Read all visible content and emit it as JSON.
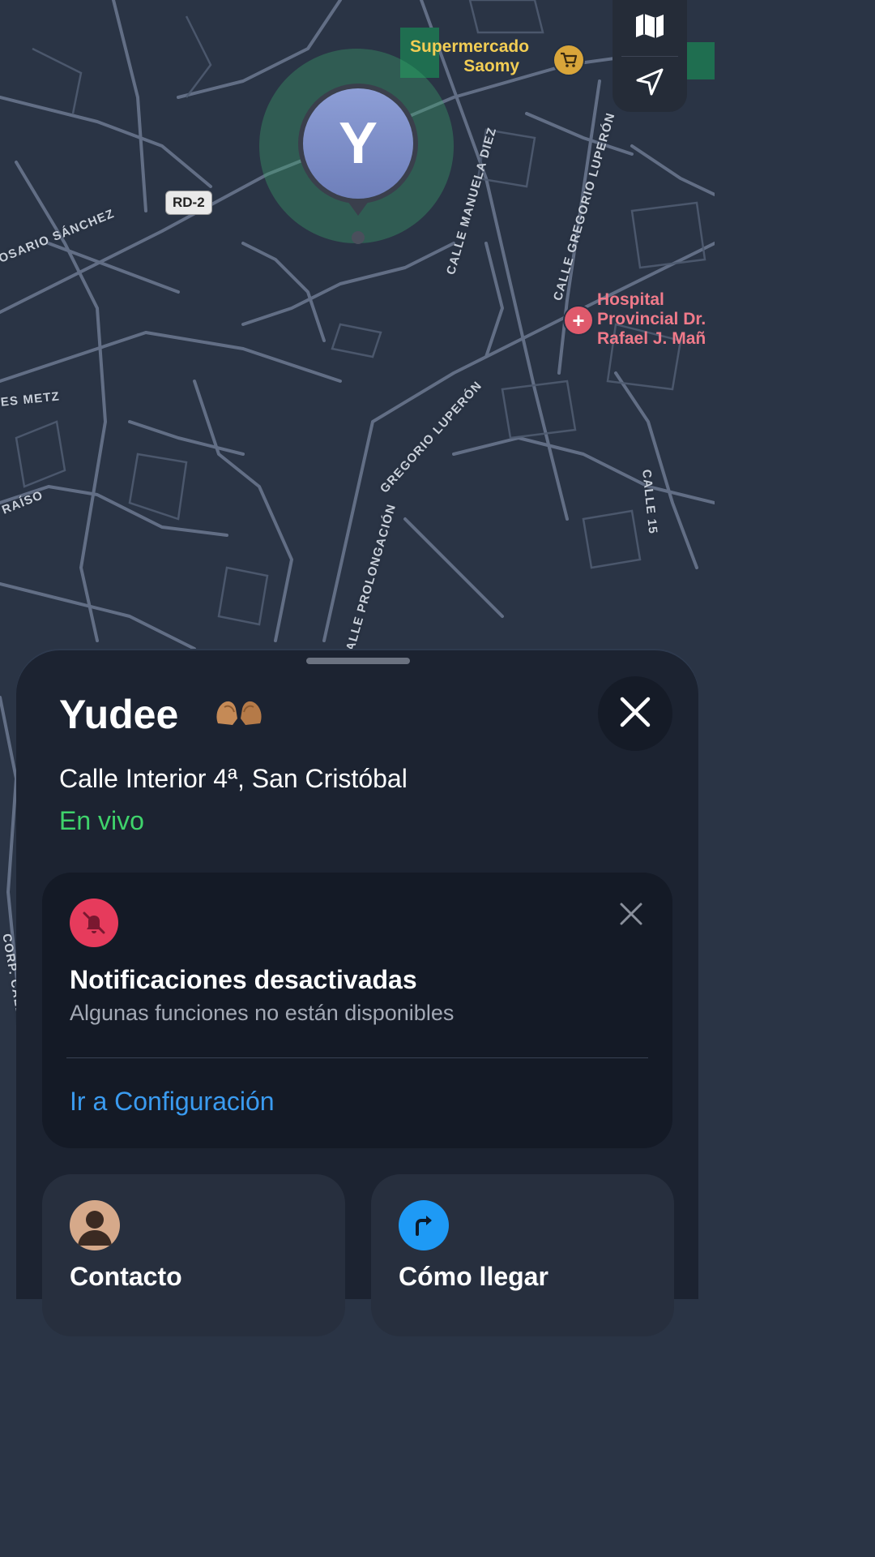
{
  "map": {
    "pois": {
      "supermarket": {
        "name_line1": "Supermercado",
        "name_line2": "Saomy",
        "color": "#f2cd54",
        "icon": "shopping-cart-icon"
      },
      "hospital": {
        "name_line1": "Hospital",
        "name_line2": "Provincial Dr.",
        "name_line3": "Rafael J. Mañ",
        "color": "#f07a8a",
        "icon": "hospital-cross-icon"
      }
    },
    "road_shield": "RD-2",
    "streets": {
      "rosario_sanchez": "OSARIO SÁNCHEZ",
      "manuela_diez": "CALLE MANUELA DIEZ",
      "gregorio_luperon_1": "CALLE GREGORIO LUPERÓN",
      "gregorio_luperon_2": "GREGORIO LUPERÓN",
      "prolongacion": "ALLE PROLONGACIÓN",
      "es_metz": "ES METZ",
      "raiso": "RAÍSO",
      "calle_15": "CALLE 15",
      "corp_calle": "CORP. CALLE"
    },
    "user_pin": {
      "initial": "Y",
      "accuracy_color": "#3caa6e"
    },
    "controls": [
      {
        "icon": "map-icon"
      },
      {
        "icon": "location-arrow-icon"
      }
    ]
  },
  "sheet": {
    "name": "Yudee",
    "name_emoji": "heart-hands-emoji",
    "address": "Calle Interior 4ª, San Cristóbal",
    "status": "En vivo",
    "status_color": "#3fd36b",
    "notification_card": {
      "title": "Notificaciones desactivadas",
      "subtitle": "Algunas funciones no están disponibles",
      "link": "Ir a Configuración",
      "icon": "bell-slash-icon",
      "link_color": "#3a9bf0"
    },
    "actions": [
      {
        "label": "Contacto",
        "icon": "person-icon"
      },
      {
        "label": "Cómo llegar",
        "icon": "turn-right-arrow-icon"
      }
    ]
  }
}
